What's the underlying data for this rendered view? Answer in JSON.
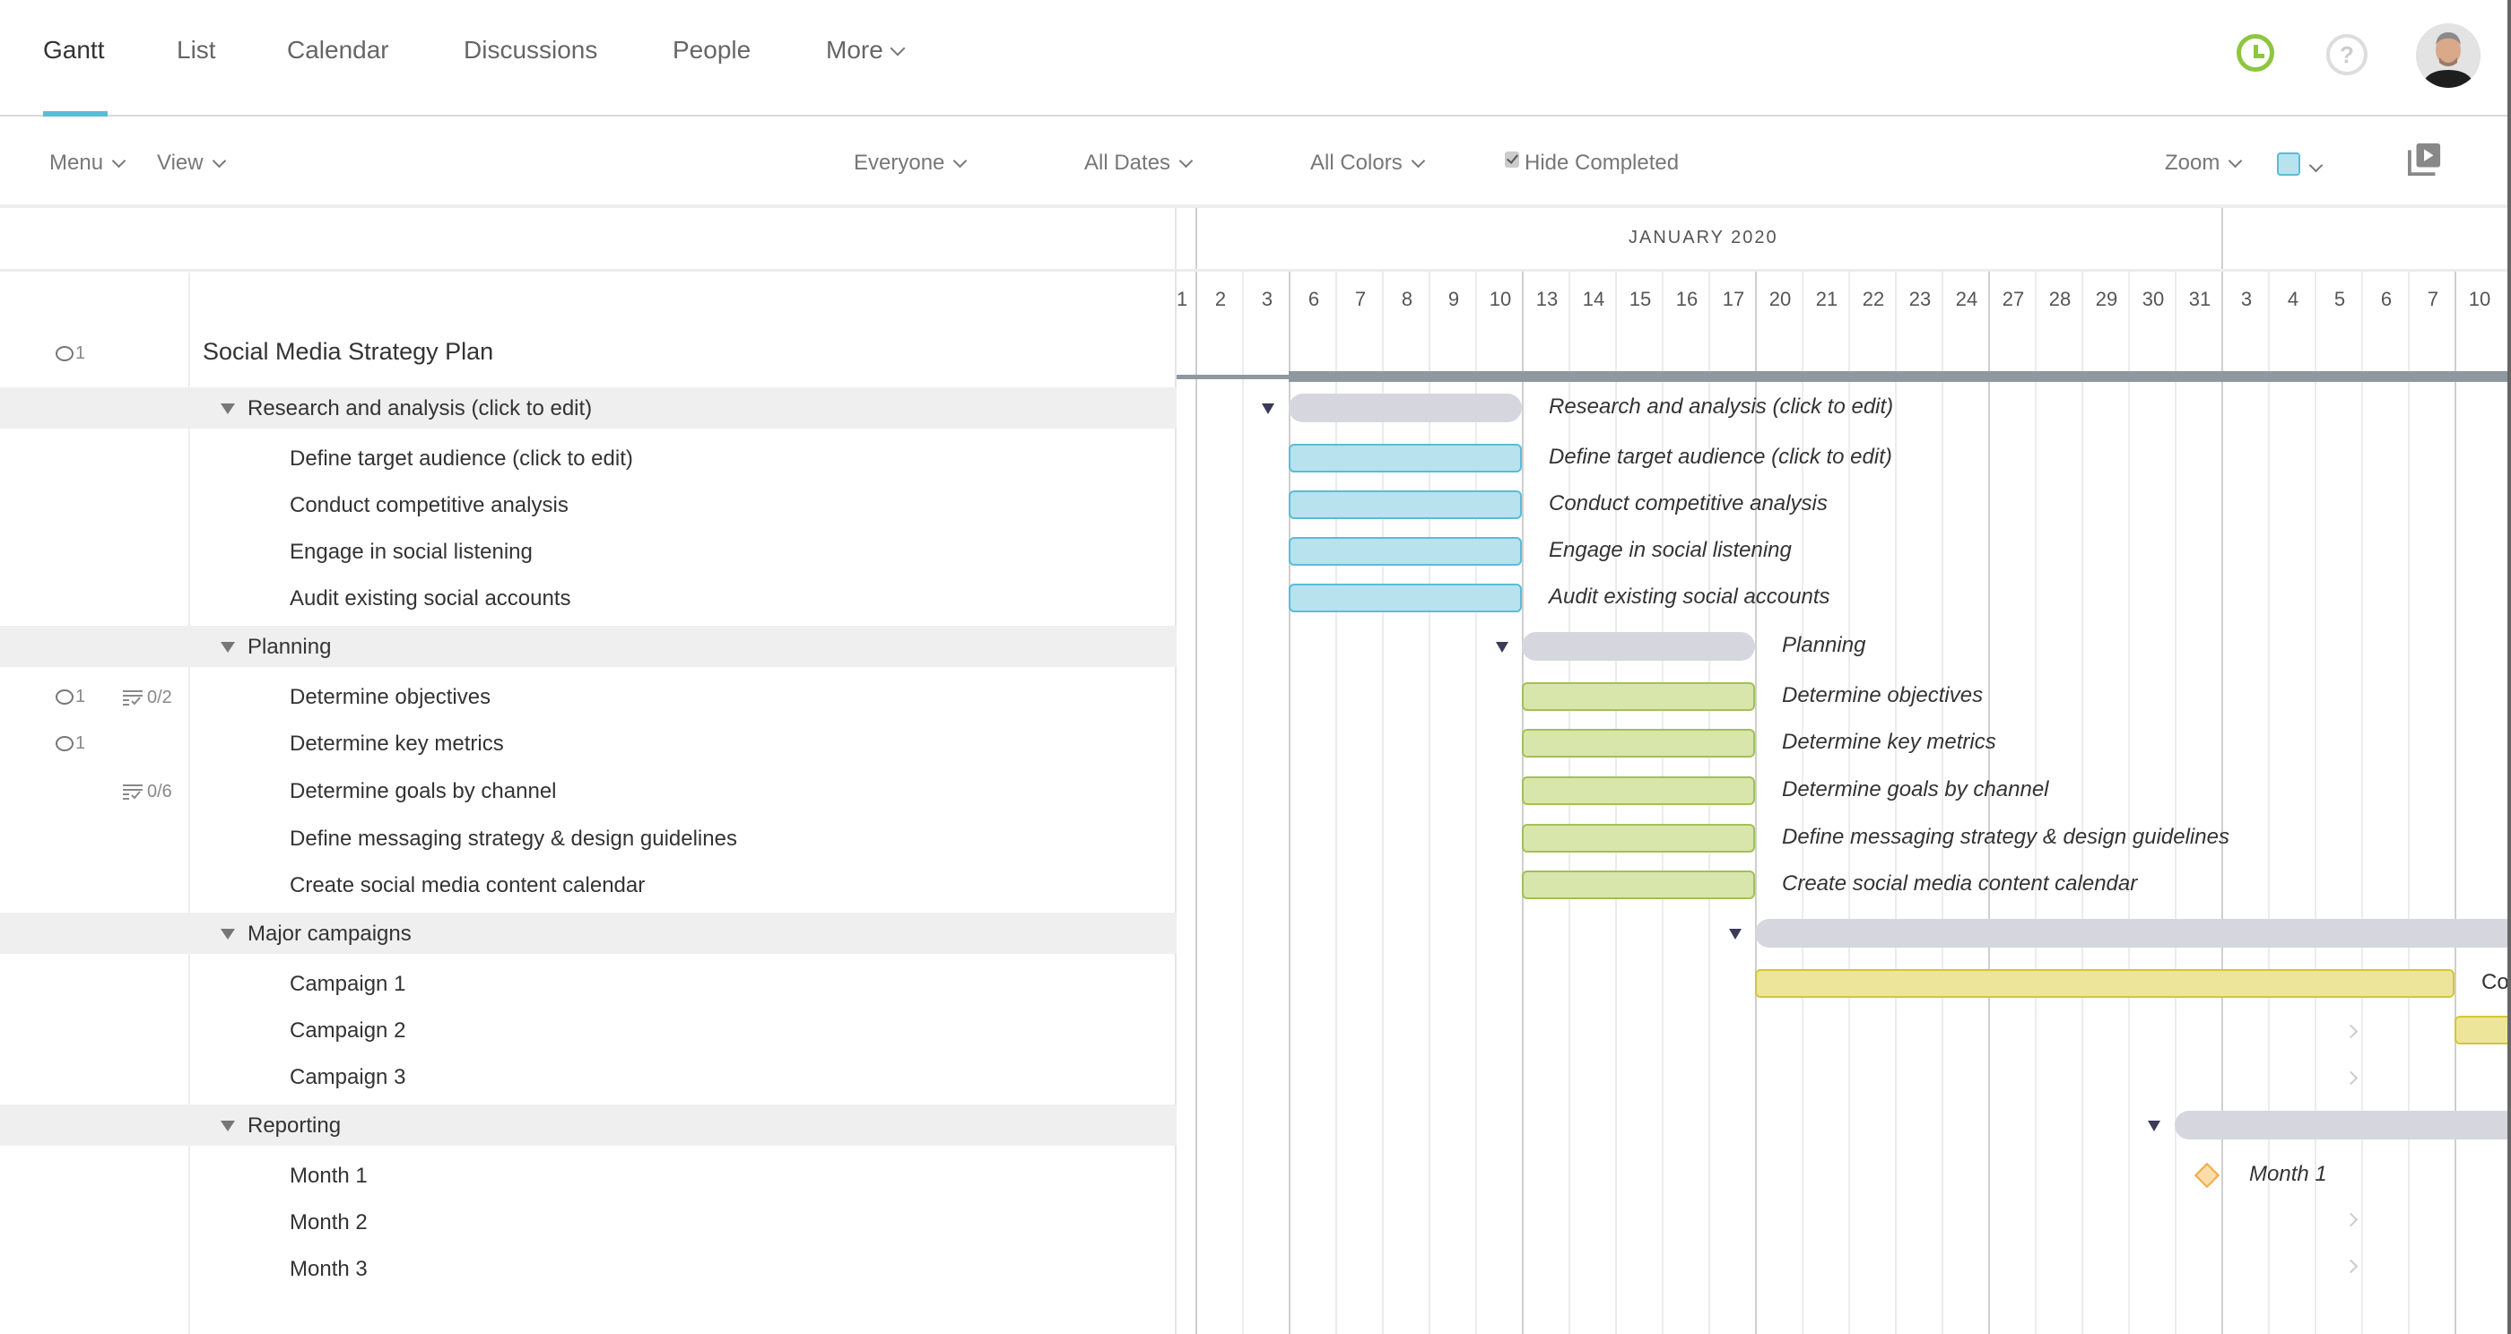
{
  "nav": {
    "tabs": [
      {
        "label": "Gantt",
        "active": true
      },
      {
        "label": "List",
        "active": false
      },
      {
        "label": "Calendar",
        "active": false
      },
      {
        "label": "Discussions",
        "active": false
      },
      {
        "label": "People",
        "active": false
      },
      {
        "label": "More",
        "active": false
      }
    ],
    "icons": {
      "timer": "clock-icon",
      "help": "question-mark-icon",
      "help_glyph": "?",
      "avatar": "user-avatar"
    }
  },
  "toolbar": {
    "menu_label": "Menu",
    "view_label": "View",
    "everyone_label": "Everyone",
    "dates_label": "All Dates",
    "colors_label": "All Colors",
    "hide_completed_label": "Hide Completed",
    "hide_completed_checked": true,
    "zoom_label": "Zoom",
    "color_swatch": "#b8e2ee"
  },
  "timeline": {
    "month_label": "JANUARY 2020",
    "days": [
      "1",
      "2",
      "3",
      "6",
      "7",
      "8",
      "9",
      "10",
      "13",
      "14",
      "15",
      "16",
      "17",
      "20",
      "21",
      "22",
      "23",
      "24",
      "27",
      "28",
      "29",
      "30",
      "31",
      "3",
      "4",
      "5",
      "6",
      "7",
      "10"
    ]
  },
  "project": {
    "title": "Social Media Strategy Plan",
    "comments": "1"
  },
  "groups": [
    {
      "name": "Research and analysis (click to edit)",
      "tasks": [
        {
          "name": "Define target audience (click to edit)",
          "color": "blue"
        },
        {
          "name": "Conduct competitive analysis",
          "color": "blue"
        },
        {
          "name": "Engage in social listening",
          "color": "blue"
        },
        {
          "name": "Audit existing social accounts",
          "color": "blue"
        }
      ]
    },
    {
      "name": "Planning",
      "tasks": [
        {
          "name": "Determine objectives",
          "color": "green",
          "comments": "1",
          "checklist": "0/2"
        },
        {
          "name": "Determine key metrics",
          "color": "green",
          "comments": "1"
        },
        {
          "name": "Determine goals by channel",
          "color": "green",
          "checklist": "0/6"
        },
        {
          "name": "Define messaging strategy & design guidelines",
          "color": "green"
        },
        {
          "name": "Create social media content calendar",
          "color": "green"
        }
      ]
    },
    {
      "name": "Major campaigns",
      "tasks": [
        {
          "name": "Campaign 1",
          "color": "yellow",
          "bar_label_visible": "Co"
        },
        {
          "name": "Campaign 2",
          "color": "yellow"
        },
        {
          "name": "Campaign 3",
          "color": "yellow"
        }
      ]
    },
    {
      "name": "Reporting",
      "tasks": [
        {
          "name": "Month 1",
          "type": "milestone"
        },
        {
          "name": "Month 2",
          "type": "milestone"
        },
        {
          "name": "Month 3",
          "type": "milestone"
        }
      ]
    }
  ],
  "colors": {
    "accent": "#5bbcd6",
    "blue_bar": "#b8e2ee",
    "green_bar": "#d8e6ab",
    "yellow_bar": "#ede59a",
    "summary_bar": "#d6d7de",
    "project_bar": "#8f989f",
    "milestone": "#fcdcaa",
    "timer": "#8dc63f"
  }
}
